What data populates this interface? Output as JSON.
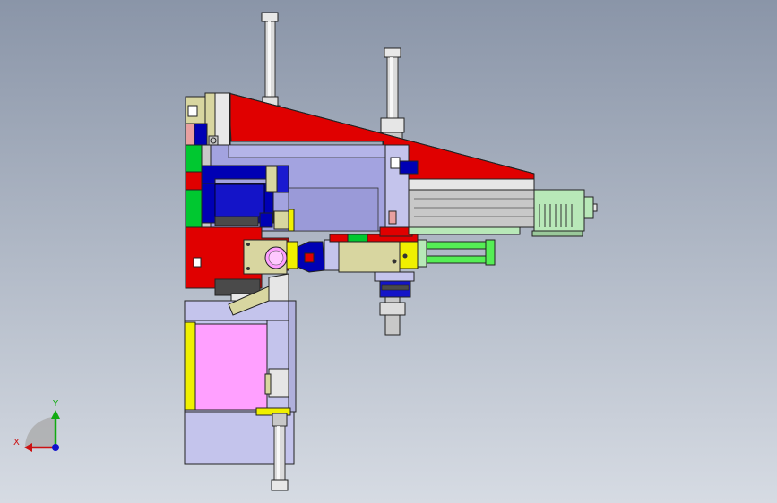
{
  "viewport": {
    "background_top": "#8a95a8",
    "background_bottom": "#d6dbe3"
  },
  "triad": {
    "x_label": "X",
    "y_label": "Y",
    "x_color": "#cc1111",
    "y_color": "#11aa11",
    "z_color": "#1111cc"
  },
  "palette": {
    "red": "#e00000",
    "lavender": "#a3a3e0",
    "light_lavender": "#c4c4ec",
    "navy": "#0000b4",
    "green": "#00c830",
    "bright_green": "#55ee55",
    "khaki": "#d8d6a0",
    "yellow": "#f0f000",
    "pink": "#ffa0ff",
    "grey": "#c8c8c8",
    "dark_grey": "#4a4a4a",
    "pale_green": "#b8e8b8"
  }
}
